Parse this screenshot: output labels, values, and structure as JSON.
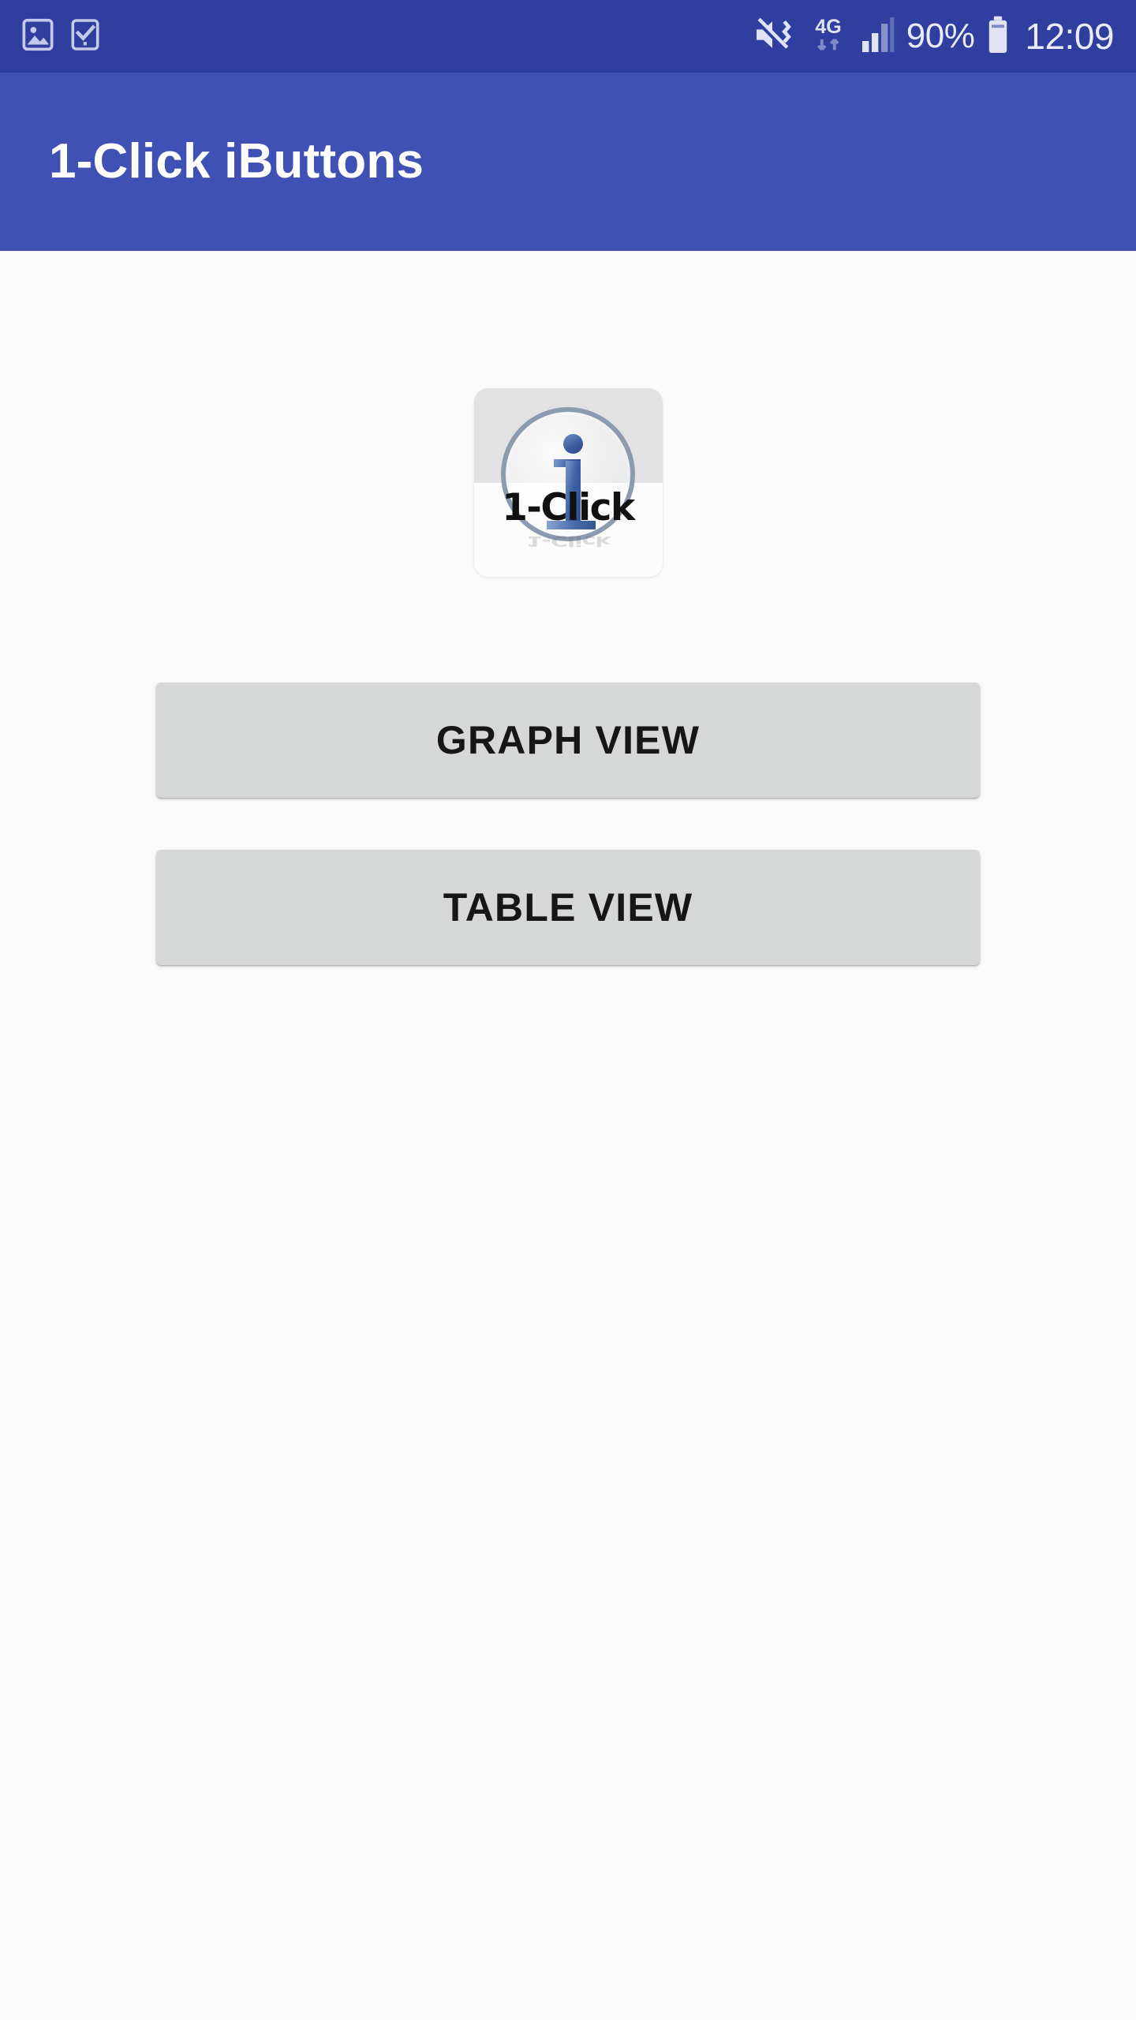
{
  "status_bar": {
    "background": "#303f9f",
    "left_icons": [
      {
        "name": "image-icon",
        "label": "Photo"
      },
      {
        "name": "task-checkbox-icon",
        "label": "Task"
      }
    ],
    "right_icons": [
      {
        "name": "mute-vibrate-icon",
        "label": "Silent / vibrate"
      },
      {
        "name": "network-4g-icon",
        "label": "4G"
      },
      {
        "name": "signal-bars-icon",
        "label": "Signal"
      },
      {
        "name": "battery-icon",
        "label": "Battery"
      }
    ],
    "network_label": "4G",
    "battery_percent": "90%",
    "clock": "12:09"
  },
  "app_bar": {
    "title": "1-Click iButtons",
    "background": "#3f51b5",
    "text_color": "#ffffff"
  },
  "content": {
    "background": "#fafafa",
    "logo": {
      "name": "app-logo",
      "wordmark": "1-Click",
      "letter": "i",
      "alt": "1-Click iButtons logo"
    },
    "buttons": [
      {
        "name": "graph-view-button",
        "label": "GRAPH VIEW"
      },
      {
        "name": "table-view-button",
        "label": "TABLE VIEW"
      }
    ]
  },
  "colors": {
    "status_bar": "#303f9f",
    "app_bar": "#3f51b5",
    "page_background": "#fafafa",
    "button_face": "#d6d7d7",
    "button_text": "#161616",
    "logo_blue": "#3f62a6"
  }
}
